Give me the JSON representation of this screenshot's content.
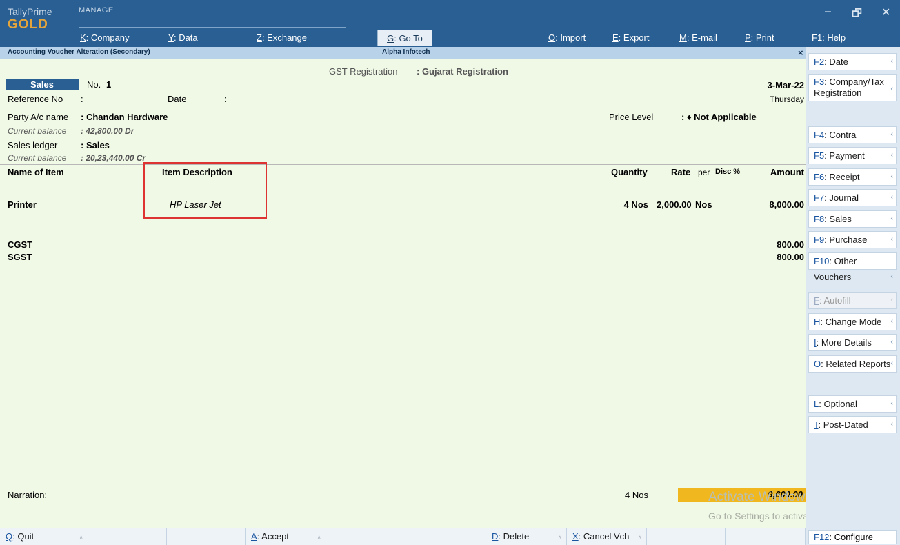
{
  "brand": {
    "line1": "TallyPrime",
    "line2": "GOLD"
  },
  "manage_label": "MANAGE",
  "menu": [
    {
      "key": "K",
      "label": ": Company"
    },
    {
      "key": "Y",
      "label": ": Data"
    },
    {
      "key": "Z",
      "label": ": Exchange"
    },
    {
      "key": "G",
      "label": ": Go To"
    },
    {
      "key": "O",
      "label": ": Import"
    },
    {
      "key": "E",
      "label": ": Export"
    },
    {
      "key": "M",
      "label": ": E-mail"
    },
    {
      "key": "P",
      "label": ": Print"
    }
  ],
  "help": "F1: Help",
  "window_controls": {
    "minimize": "–",
    "restore": "🗗",
    "close": "✕"
  },
  "titlebar": {
    "left": "Accounting Voucher Alteration (Secondary)",
    "center": "Alpha Infotech",
    "close": "×"
  },
  "gst": {
    "label": "GST Registration",
    "value": ": Gujarat Registration"
  },
  "voucher": {
    "type": "Sales",
    "no_label": "No.",
    "no_value": "1",
    "date": "3-Mar-22",
    "day": "Thursday",
    "ref_label": "Reference No",
    "ref_colon": ":",
    "date_label": "Date",
    "date_colon": ":",
    "party_label": "Party A/c name",
    "party_value": ": Chandan Hardware",
    "party_balance_label": "Current balance",
    "party_balance_value": ":   42,800.00 Dr",
    "price_level_label": "Price Level",
    "price_level_value": ": ♦ Not Applicable",
    "sales_ledger_label": "Sales ledger",
    "sales_ledger_value": ": Sales",
    "sales_balance_label": "Current balance",
    "sales_balance_value": ": 20,23,440.00 Cr"
  },
  "table_headers": {
    "name": "Name of Item",
    "desc": "Item Description",
    "qty": "Quantity",
    "rate": "Rate",
    "per": "per",
    "disc": "Disc %",
    "amount": "Amount"
  },
  "items": [
    {
      "name": "Printer",
      "desc": "HP Laser Jet",
      "qty": "4 Nos",
      "rate": "2,000.00",
      "per": "Nos",
      "amount": "8,000.00"
    }
  ],
  "taxes": [
    {
      "name": "CGST",
      "amount": "800.00"
    },
    {
      "name": "SGST",
      "amount": "800.00"
    }
  ],
  "narration_label": "Narration:",
  "totals": {
    "qty": "4 Nos",
    "amount": "9,600.00"
  },
  "watermark": {
    "line1": "Activate Windows",
    "line2": "Go to Settings to activate Windows."
  },
  "right_panel": [
    {
      "key": "F2",
      "label": ": Date",
      "enabled": true
    },
    {
      "key": "F3",
      "label": ": Company/Tax Registration",
      "enabled": true
    },
    {
      "key": "F4",
      "label": ": Contra",
      "enabled": true
    },
    {
      "key": "F5",
      "label": ": Payment",
      "enabled": true
    },
    {
      "key": "F6",
      "label": ": Receipt",
      "enabled": true
    },
    {
      "key": "F7",
      "label": ": Journal",
      "enabled": true
    },
    {
      "key": "F8",
      "label": ": Sales",
      "enabled": true
    },
    {
      "key": "F9",
      "label": ": Purchase",
      "enabled": true
    },
    {
      "key": "F10",
      "label": ": Other Vouchers",
      "enabled": true
    },
    {
      "key": "F",
      "label": ": Autofill",
      "enabled": false
    },
    {
      "key": "H",
      "label": ": Change Mode",
      "enabled": true
    },
    {
      "key": "I",
      "label": ": More Details",
      "enabled": true
    },
    {
      "key": "O",
      "label": ": Related Reports",
      "enabled": true
    },
    {
      "key": "L",
      "label": ": Optional",
      "enabled": true
    },
    {
      "key": "T",
      "label": ": Post-Dated",
      "enabled": true
    }
  ],
  "bottom_bar": [
    {
      "key": "Q",
      "label": ": Quit"
    },
    {
      "key": "",
      "label": ""
    },
    {
      "key": "",
      "label": ""
    },
    {
      "key": "A",
      "label": ": Accept"
    },
    {
      "key": "",
      "label": ""
    },
    {
      "key": "",
      "label": ""
    },
    {
      "key": "D",
      "label": ": Delete"
    },
    {
      "key": "X",
      "label": ": Cancel Vch"
    },
    {
      "key": "",
      "label": ""
    },
    {
      "key": "",
      "label": ""
    }
  ],
  "f12": {
    "key": "F12",
    "label": ": Configure"
  },
  "chevron": "‹",
  "caret": "∧"
}
